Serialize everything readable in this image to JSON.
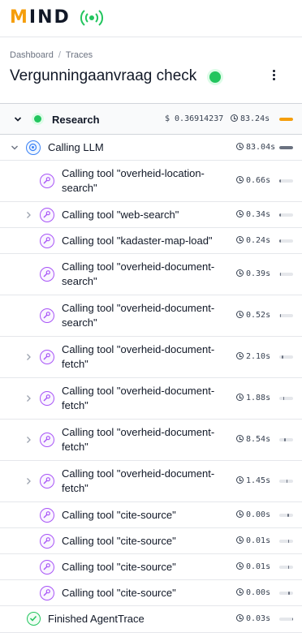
{
  "app": {
    "logo_text": "MIND"
  },
  "breadcrumb": {
    "items": [
      "Dashboard",
      "Traces"
    ]
  },
  "page": {
    "title": "Vergunningaanvraag check"
  },
  "colors": {
    "accent": "#f59e0b",
    "success": "#22c55e",
    "llm": "#3b82f6",
    "tool": "#a855f7"
  },
  "research": {
    "label": "Research",
    "cost": "$ 0.36914237",
    "duration": "83.24s",
    "progress": 1.0
  },
  "llm": {
    "label": "Calling LLM",
    "duration": "83.04s",
    "progress": 1.0
  },
  "tools": [
    {
      "label": "Calling tool \"overheid-location-search\"",
      "duration": "0.66s",
      "expandable": false,
      "progress_start": 0.0,
      "progress": 0.01
    },
    {
      "label": "Calling tool \"web-search\"",
      "duration": "0.34s",
      "expandable": true,
      "progress_start": 0.01,
      "progress": 0.005
    },
    {
      "label": "Calling tool \"kadaster-map-load\"",
      "duration": "0.24s",
      "expandable": false,
      "progress_start": 0.02,
      "progress": 0.003
    },
    {
      "label": "Calling tool \"overheid-document-search\"",
      "duration": "0.39s",
      "expandable": false,
      "progress_start": 0.03,
      "progress": 0.005
    },
    {
      "label": "Calling tool \"overheid-document-search\"",
      "duration": "0.52s",
      "expandable": false,
      "progress_start": 0.05,
      "progress": 0.006
    },
    {
      "label": "Calling tool \"overheid-document-fetch\"",
      "duration": "2.10s",
      "expandable": true,
      "progress_start": 0.2,
      "progress": 0.025
    },
    {
      "label": "Calling tool \"overheid-document-fetch\"",
      "duration": "1.88s",
      "expandable": true,
      "progress_start": 0.28,
      "progress": 0.023
    },
    {
      "label": "Calling tool \"overheid-document-fetch\"",
      "duration": "8.54s",
      "expandable": true,
      "progress_start": 0.35,
      "progress": 0.1
    },
    {
      "label": "Calling tool \"overheid-document-fetch\"",
      "duration": "1.45s",
      "expandable": true,
      "progress_start": 0.5,
      "progress": 0.017
    },
    {
      "label": "Calling tool \"cite-source\"",
      "duration": "0.00s",
      "expandable": false,
      "progress_start": 0.6,
      "progress": 0.002
    },
    {
      "label": "Calling tool \"cite-source\"",
      "duration": "0.01s",
      "expandable": false,
      "progress_start": 0.62,
      "progress": 0.002
    },
    {
      "label": "Calling tool \"cite-source\"",
      "duration": "0.01s",
      "expandable": false,
      "progress_start": 0.64,
      "progress": 0.002
    },
    {
      "label": "Calling tool \"cite-source\"",
      "duration": "0.00s",
      "expandable": false,
      "progress_start": 0.66,
      "progress": 0.002
    }
  ],
  "finished": {
    "label": "Finished AgentTrace",
    "duration": "0.03s",
    "progress_start": 0.99,
    "progress": 0.001
  },
  "icons": {
    "menu": "kebab-menu-icon",
    "expand": "chevron-icon",
    "clock": "clock-icon",
    "tool": "wrench-icon",
    "llm": "brain-icon",
    "done": "check-circle-icon",
    "live": "live-signal-icon"
  }
}
